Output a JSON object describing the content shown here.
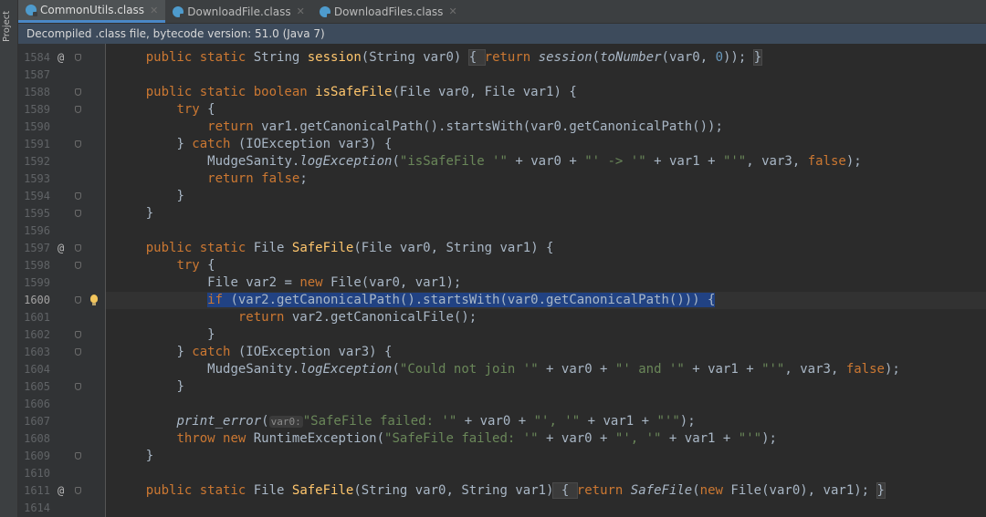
{
  "sidebar": {
    "project_label": "Project"
  },
  "tabs": [
    {
      "label": "CommonUtils.class",
      "active": true
    },
    {
      "label": "DownloadFile.class",
      "active": false
    },
    {
      "label": "DownloadFiles.class",
      "active": false
    }
  ],
  "banner": {
    "text": "Decompiled .class file, bytecode version: 51.0 (Java 7)"
  },
  "editor": {
    "current_line": "1600",
    "lines": [
      {
        "num": "1584",
        "marker": "@",
        "fold": true
      },
      {
        "num": "1587"
      },
      {
        "num": "1588",
        "fold": true
      },
      {
        "num": "1589",
        "fold": true
      },
      {
        "num": "1590"
      },
      {
        "num": "1591",
        "fold": true
      },
      {
        "num": "1592"
      },
      {
        "num": "1593"
      },
      {
        "num": "1594",
        "fold": true
      },
      {
        "num": "1595",
        "fold": true
      },
      {
        "num": "1596"
      },
      {
        "num": "1597",
        "marker": "@",
        "fold": true
      },
      {
        "num": "1598",
        "fold": true
      },
      {
        "num": "1599"
      },
      {
        "num": "1600",
        "fold": true,
        "bulb": true
      },
      {
        "num": "1601"
      },
      {
        "num": "1602",
        "fold": true
      },
      {
        "num": "1603",
        "fold": true
      },
      {
        "num": "1604"
      },
      {
        "num": "1605",
        "fold": true
      },
      {
        "num": "1606"
      },
      {
        "num": "1607"
      },
      {
        "num": "1608"
      },
      {
        "num": "1609",
        "fold": true
      },
      {
        "num": "1610"
      },
      {
        "num": "1611",
        "marker": "@",
        "fold": true
      },
      {
        "num": "1614"
      }
    ],
    "code": {
      "l1584": {
        "kw": "public static ",
        "type": "String ",
        "name": "session",
        "args": "(String var0) ",
        "body_open": "{ ",
        "ret": "return ",
        "call": "session",
        "p1": "(",
        "call2": "toNumber",
        "p2": "(var0, ",
        "zero": "0",
        "p3": ")); ",
        "body_close": "}"
      },
      "l1588": {
        "kw": "public static boolean ",
        "name": "isSafeFile",
        "args": "(File var0, File var1) {"
      },
      "l1589": {
        "kw": "try ",
        "rest": "{"
      },
      "l1590": {
        "kw": "return ",
        "rest": "var1.getCanonicalPath().startsWith(var0.getCanonicalPath());"
      },
      "l1591": {
        "pre": "} ",
        "kw": "catch ",
        "rest": "(IOException var3) {"
      },
      "l1592": {
        "pre": "MudgeSanity.",
        "call": "logException",
        "p1": "(",
        "s1": "\"isSafeFile '\"",
        "p2": " + var0 + ",
        "s2": "\"' -> '\"",
        "p3": " + var1 + ",
        "s3": "\"'\"",
        "p4": ", var3, ",
        "kw": "false",
        "p5": ");"
      },
      "l1593": {
        "kw": "return false",
        "rest": ";"
      },
      "l1594": {
        "rest": "}"
      },
      "l1595": {
        "rest": "}"
      },
      "l1597": {
        "kw": "public static ",
        "type": "File ",
        "name": "SafeFile",
        "args": "(File var0, String var1) {"
      },
      "l1598": {
        "kw": "try ",
        "rest": "{"
      },
      "l1599": {
        "pre": "File var2 = ",
        "kw": "new ",
        "rest": "File(var0, var1);"
      },
      "l1600": {
        "kw": "if ",
        "rest": "(var2.getCanonicalPath().startsWith(var0.getCanonicalPath())) {"
      },
      "l1601": {
        "kw": "return ",
        "rest": "var2.getCanonicalFile();"
      },
      "l1602": {
        "rest": "}"
      },
      "l1603": {
        "pre": "} ",
        "kw": "catch ",
        "rest": "(IOException var3) {"
      },
      "l1604": {
        "pre": "MudgeSanity.",
        "call": "logException",
        "p1": "(",
        "s1": "\"Could not join '\"",
        "p2": " + var0 + ",
        "s2": "\"' and '\"",
        "p3": " + var1 + ",
        "s3": "\"'\"",
        "p4": ", var3, ",
        "kw": "false",
        "p5": ");"
      },
      "l1605": {
        "rest": "}"
      },
      "l1607": {
        "call": "print_error",
        "p1": "(",
        "hint": "var0:",
        "s1": "\"SafeFile failed: '\"",
        "p2": " + var0 + ",
        "s2": "\"', '\"",
        "p3": " + var1 + ",
        "s3": "\"'\"",
        "p4": ");"
      },
      "l1608": {
        "kw": "throw new ",
        "pre": "RuntimeException(",
        "s1": "\"SafeFile failed: '\"",
        "p2": " + var0 + ",
        "s2": "\"', '\"",
        "p3": " + var1 + ",
        "s3": "\"'\"",
        "p4": ");"
      },
      "l1609": {
        "rest": "}"
      },
      "l1611": {
        "kw": "public static ",
        "type": "File ",
        "name": "SafeFile",
        "args": "(String var0, String var1)",
        "body_open": " { ",
        "ret": "return ",
        "call": "SafeFile",
        "p1": "(",
        "kw2": "new ",
        "p2": "File(var0), var1); ",
        "body_close": "}"
      }
    }
  },
  "colors": {
    "keyword": "#cc7832",
    "string": "#6a8759",
    "number": "#6897bb",
    "method": "#ffc66d",
    "plain": "#a9b7c6",
    "selection": "#214283"
  }
}
